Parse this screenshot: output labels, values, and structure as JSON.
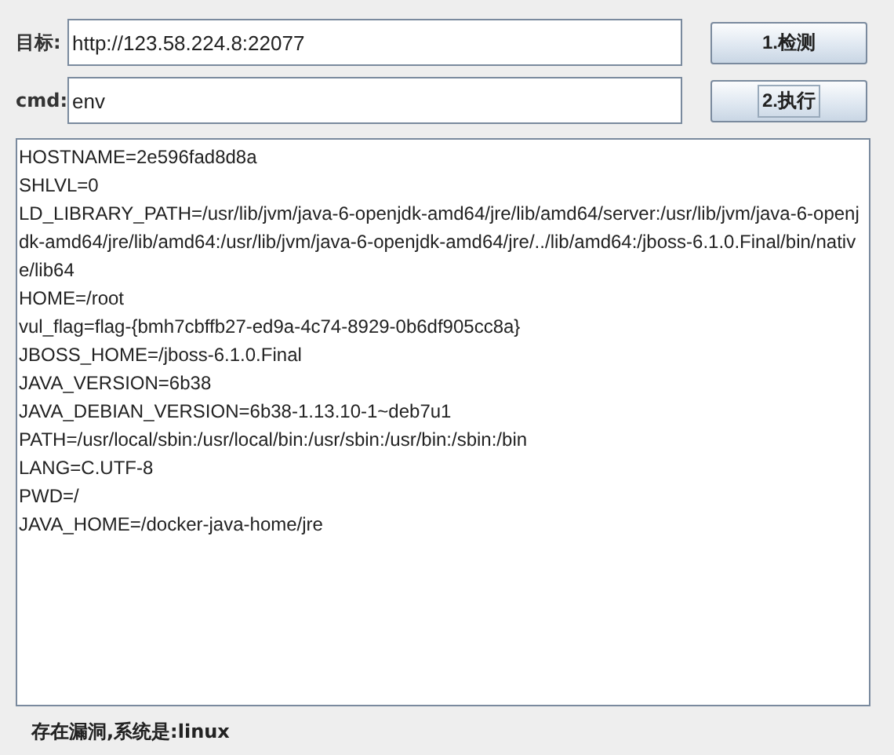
{
  "target": {
    "label": "目标:",
    "value": "http://123.58.224.8:22077"
  },
  "cmd": {
    "label": "cmd:",
    "value": "env"
  },
  "buttons": [
    {
      "label": "1.检测",
      "focused": false
    },
    {
      "label": "2.执行",
      "focused": true
    }
  ],
  "output": [
    "HOSTNAME=2e596fad8d8a",
    "SHLVL=0",
    "LD_LIBRARY_PATH=/usr/lib/jvm/java-6-openjdk-amd64/jre/lib/amd64/server:/usr/lib/jvm/java-6-openjdk-amd64/jre/lib/amd64:/usr/lib/jvm/java-6-openjdk-amd64/jre/../lib/amd64:/jboss-6.1.0.Final/bin/native/lib64",
    "HOME=/root",
    "vul_flag=flag-{bmh7cbffb27-ed9a-4c74-8929-0b6df905cc8a}",
    "JBOSS_HOME=/jboss-6.1.0.Final",
    "JAVA_VERSION=6b38",
    "JAVA_DEBIAN_VERSION=6b38-1.13.10-1~deb7u1",
    "PATH=/usr/local/sbin:/usr/local/bin:/usr/sbin:/usr/bin:/sbin:/bin",
    "LANG=C.UTF-8",
    "PWD=/",
    "JAVA_HOME=/docker-java-home/jre"
  ],
  "status": "存在漏洞,系统是:linux"
}
